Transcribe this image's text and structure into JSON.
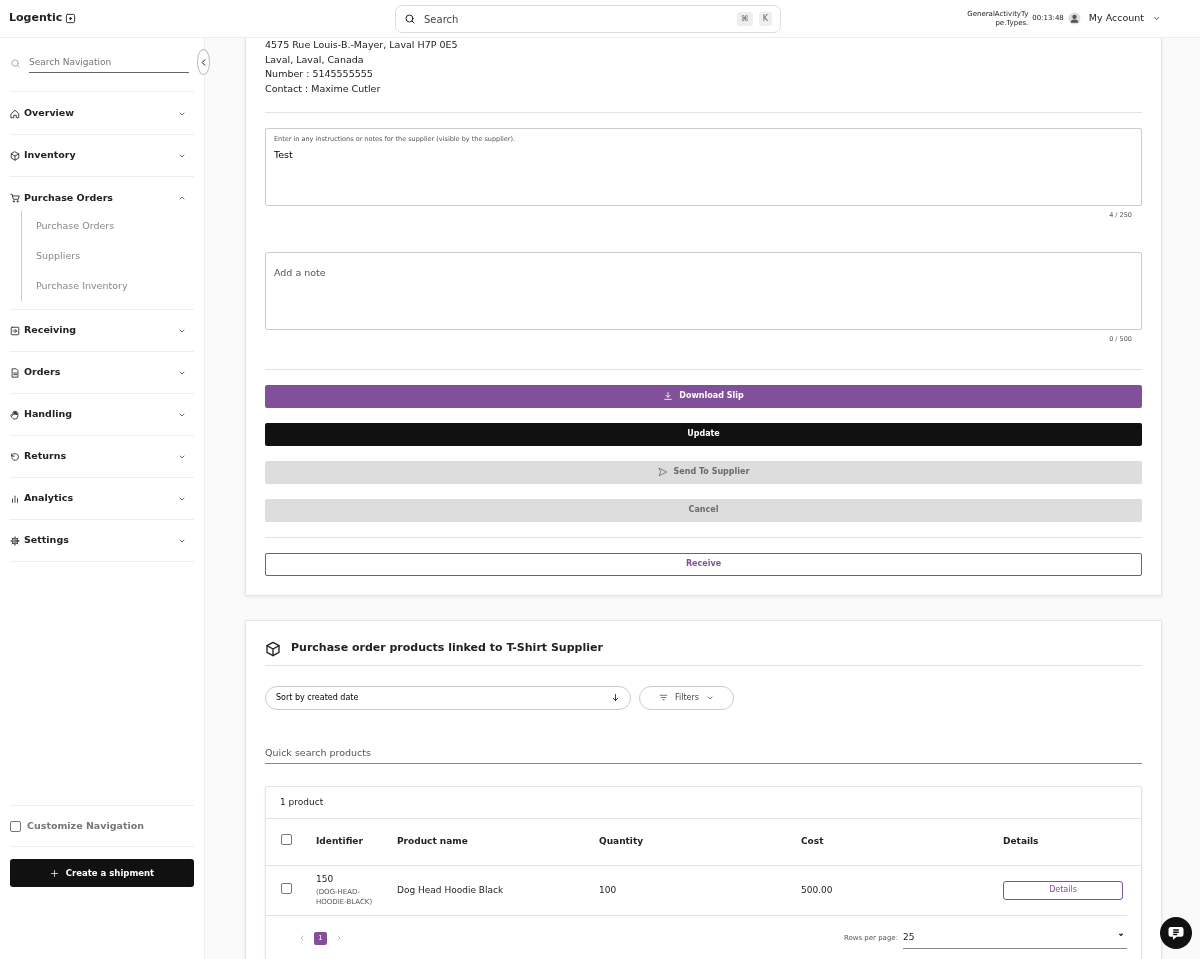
{
  "header": {
    "logo": "Logentic",
    "search": {
      "placeholder": "Search",
      "shortcut": [
        "⌘",
        "K"
      ]
    },
    "activity": "GeneralActivityType.Types.",
    "timer": "00:13:48",
    "account": "My Account"
  },
  "sidebar": {
    "search": {
      "placeholder": "Search Navigation"
    },
    "items": [
      {
        "label": "Overview",
        "expanded": false
      },
      {
        "label": "Inventory",
        "expanded": false
      },
      {
        "label": "Purchase Orders",
        "expanded": true,
        "children": [
          {
            "label": "Purchase Orders"
          },
          {
            "label": "Suppliers"
          },
          {
            "label": "Purchase Inventory"
          }
        ]
      },
      {
        "label": "Receiving",
        "expanded": false
      },
      {
        "label": "Orders",
        "expanded": false
      },
      {
        "label": "Handling",
        "expanded": false
      },
      {
        "label": "Returns",
        "expanded": false
      },
      {
        "label": "Analytics",
        "expanded": false
      },
      {
        "label": "Settings",
        "expanded": false
      }
    ],
    "customize": {
      "label": "Customize Navigation",
      "checked": false
    },
    "create_button": "Create a shipment"
  },
  "supplier": {
    "address_lines": [
      "4575 Rue Louis-B.-Mayer, Laval H7P 0E5",
      "Laval, Laval, Canada",
      "Number : 5145555555",
      "Contact : Maxime Cutler"
    ],
    "fields": [
      {
        "label": "Enter in any instructions or notes for the supplier (visible by the supplier).",
        "value": "Test",
        "counter": "4 / 250"
      },
      {
        "placeholder": "Add a note",
        "counter": "0 / 500"
      }
    ],
    "actions": [
      {
        "label": "Download Slip",
        "kind": "primary",
        "disabled": false
      },
      {
        "label": "Update",
        "kind": "dark",
        "disabled": false
      },
      {
        "label": "Send To Supplier",
        "kind": "send",
        "disabled": true
      },
      {
        "label": "Cancel",
        "kind": "plain",
        "disabled": true
      }
    ],
    "receive_button": "Receive"
  },
  "products": {
    "title": "Purchase order products linked to T-Shirt Supplier",
    "sort": "Sort by created date",
    "filters": "Filters",
    "quick_search": {
      "placeholder": "Quick search products"
    },
    "count": "1 product",
    "table": {
      "columns": [
        "Identifier",
        "Product name",
        "Quantity",
        "Cost",
        "Details"
      ],
      "all_checked": false,
      "rows": [
        {
          "checked": false,
          "identifier": "150",
          "sku": "(DOG-HEAD-HOODIE-BLACK)",
          "name": "Dog Head Hoodie Black",
          "quantity": "100",
          "cost": "500.00",
          "details": "Details"
        }
      ]
    },
    "pages": [
      {
        "label": "1",
        "selected": true
      }
    ],
    "rows_per_page_label": "Rows per page:",
    "rows_per_page": "25"
  }
}
